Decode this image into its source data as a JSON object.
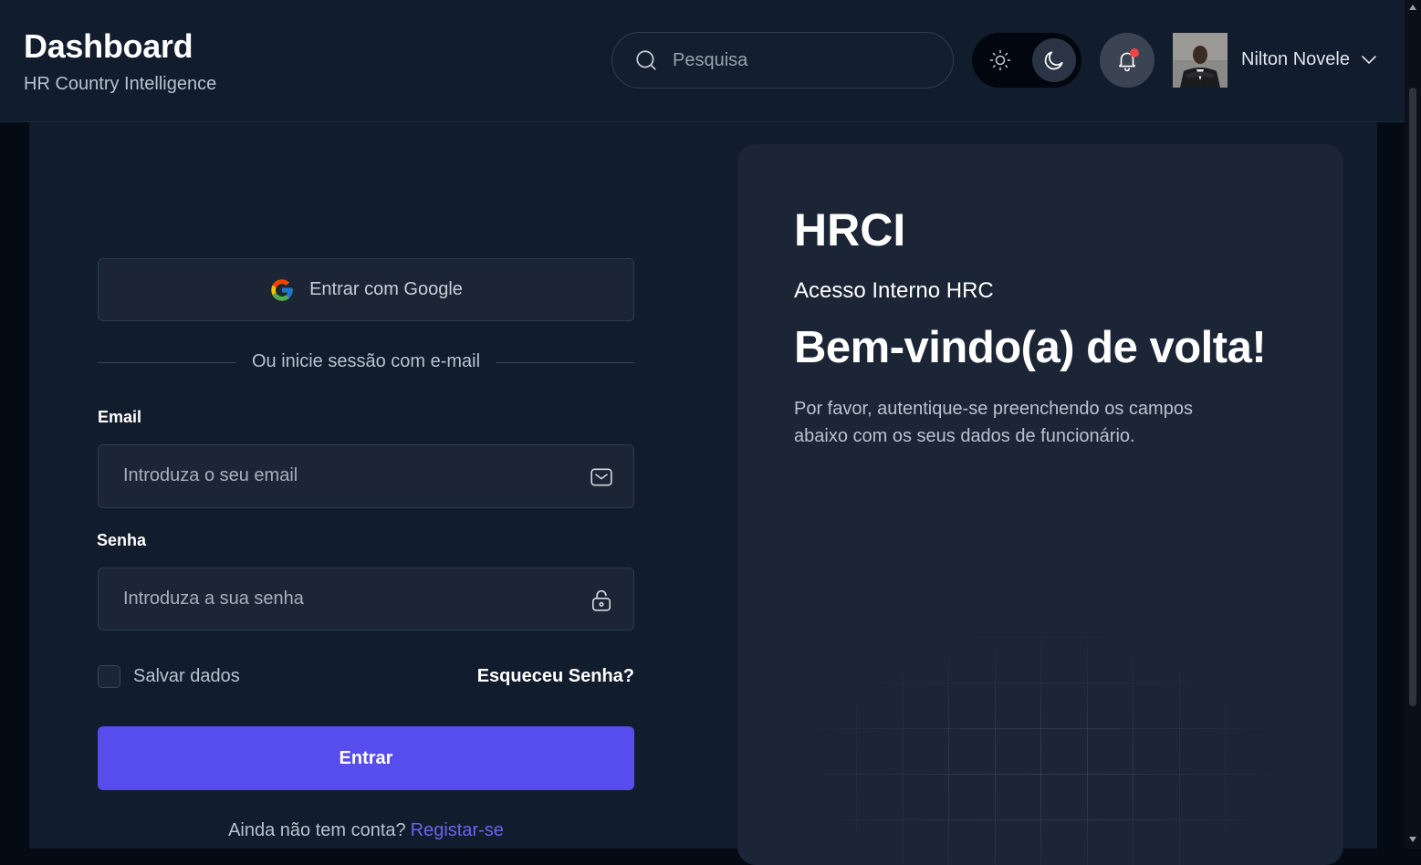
{
  "header": {
    "title": "Dashboard",
    "subtitle": "HR Country Intelligence",
    "search_placeholder": "Pesquisa",
    "user_name": "Nilton Novele"
  },
  "login": {
    "google_button": "Entrar com Google",
    "divider_text": "Ou inicie sessão com e-mail",
    "email_label": "Email",
    "email_placeholder": "Introduza o seu email",
    "password_label": "Senha",
    "password_placeholder": "Introduza a sua senha",
    "remember_label": "Salvar dados",
    "remember_checked": false,
    "forgot_link": "Esqueceu Senha?",
    "submit_label": "Entrar",
    "register_prompt": "Ainda não tem conta?",
    "register_link": "Registar-se"
  },
  "panel": {
    "title": "HRCI",
    "subtitle": "Acesso Interno HRC",
    "welcome": "Bem-vindo(a) de volta!",
    "description": "Por favor, autentique-se preenchendo os campos abaixo com os seus dados de funcionário."
  },
  "colors": {
    "accent": "#574ced",
    "link": "#6a63f2",
    "notification_dot": "#ef4444",
    "background": "#111c2c",
    "card": "#1b2535"
  },
  "icons": {
    "search": "search-icon",
    "light_mode": "sun-icon",
    "dark_mode": "moon-icon",
    "notifications": "bell-icon",
    "user_menu": "chevron-down-icon",
    "google": "google-icon",
    "email_field": "mail-icon",
    "password_field": "lock-icon"
  }
}
